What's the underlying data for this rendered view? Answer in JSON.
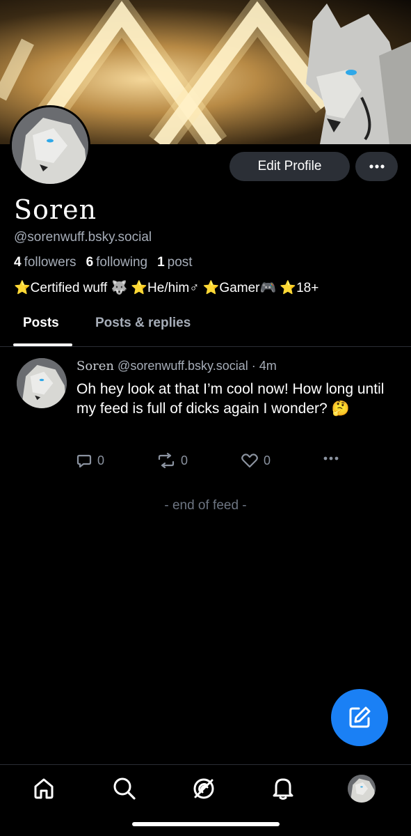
{
  "profile": {
    "display_name": "Soren",
    "handle": "@sorenwuff.bsky.social",
    "followers_count": "4",
    "followers_label": "followers",
    "following_count": "6",
    "following_label": "following",
    "posts_count": "1",
    "posts_label": "post",
    "bio": "⭐Certified wuff 🐺 ⭐He/him♂ ⭐Gamer🎮 ⭐18+"
  },
  "actions": {
    "edit_profile_label": "Edit Profile"
  },
  "tabs": [
    {
      "label": "Posts",
      "active": true
    },
    {
      "label": "Posts & replies",
      "active": false
    }
  ],
  "post": {
    "author": "Soren",
    "handle": "@sorenwuff.bsky.social",
    "separator": "·",
    "time": "4m",
    "text": "Oh hey look at that I’m cool now! How long until my feed is full of dicks again I wonder? 🤔",
    "reply_count": "0",
    "repost_count": "0",
    "like_count": "0"
  },
  "feed": {
    "end_label": "- end of feed -"
  },
  "bottom_nav": {
    "items": [
      "home-icon",
      "search-icon",
      "feeds-icon",
      "notifications-icon",
      "profile-avatar"
    ]
  },
  "colors": {
    "accent": "#1a80f5",
    "button_bg": "#2b2f36",
    "muted_text": "#a6adb8"
  }
}
